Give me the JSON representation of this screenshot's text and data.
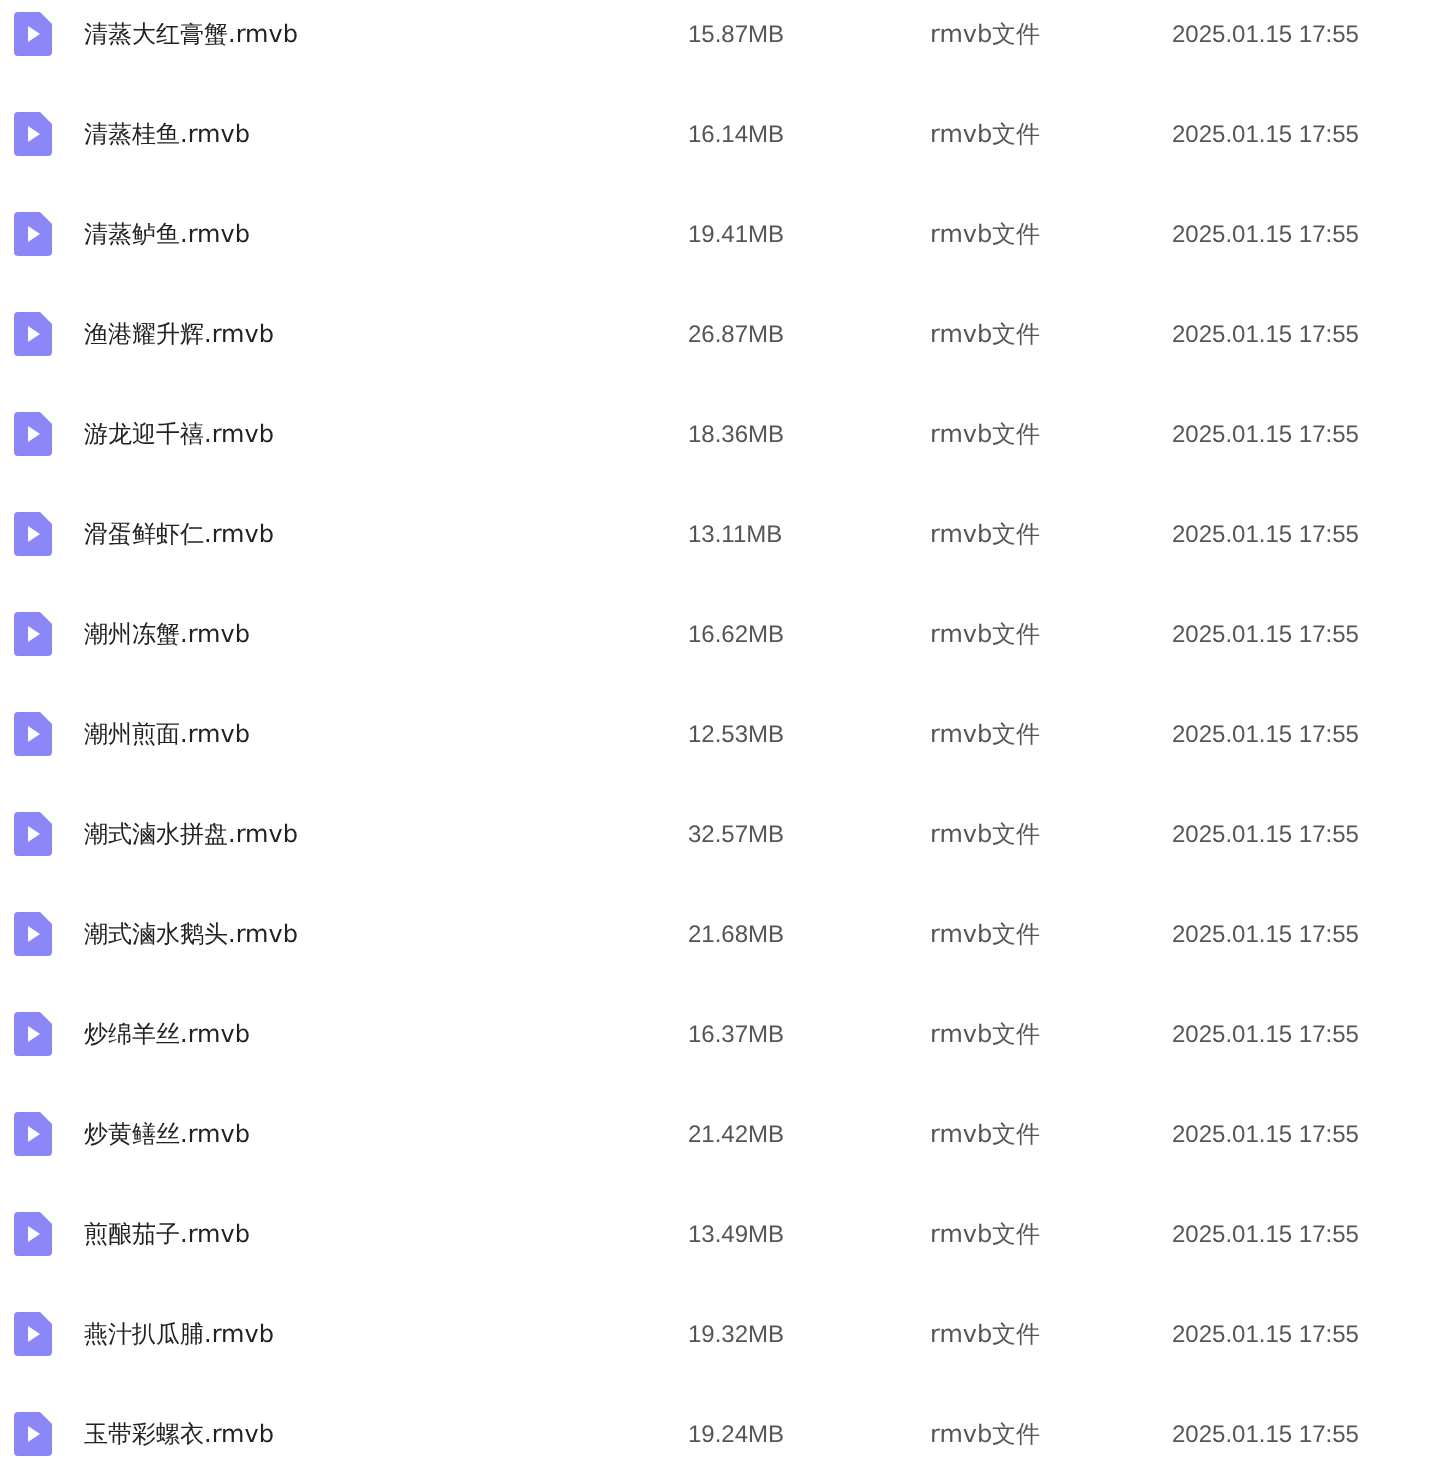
{
  "files": [
    {
      "name": "清蒸大红膏蟹.rmvb",
      "size": "15.87MB",
      "type": "rmvb文件",
      "date": "2025.01.15 17:55"
    },
    {
      "name": "清蒸桂鱼.rmvb",
      "size": "16.14MB",
      "type": "rmvb文件",
      "date": "2025.01.15 17:55"
    },
    {
      "name": "清蒸鲈鱼.rmvb",
      "size": "19.41MB",
      "type": "rmvb文件",
      "date": "2025.01.15 17:55"
    },
    {
      "name": "渔港耀升辉.rmvb",
      "size": "26.87MB",
      "type": "rmvb文件",
      "date": "2025.01.15 17:55"
    },
    {
      "name": "游龙迎千禧.rmvb",
      "size": "18.36MB",
      "type": "rmvb文件",
      "date": "2025.01.15 17:55"
    },
    {
      "name": "滑蛋鲜虾仁.rmvb",
      "size": "13.11MB",
      "type": "rmvb文件",
      "date": "2025.01.15 17:55"
    },
    {
      "name": "潮州冻蟹.rmvb",
      "size": "16.62MB",
      "type": "rmvb文件",
      "date": "2025.01.15 17:55"
    },
    {
      "name": "潮州煎面.rmvb",
      "size": "12.53MB",
      "type": "rmvb文件",
      "date": "2025.01.15 17:55"
    },
    {
      "name": "潮式滷水拼盘.rmvb",
      "size": "32.57MB",
      "type": "rmvb文件",
      "date": "2025.01.15 17:55"
    },
    {
      "name": "潮式滷水鹅头.rmvb",
      "size": "21.68MB",
      "type": "rmvb文件",
      "date": "2025.01.15 17:55"
    },
    {
      "name": "炒绵羊丝.rmvb",
      "size": "16.37MB",
      "type": "rmvb文件",
      "date": "2025.01.15 17:55"
    },
    {
      "name": "炒黄鳝丝.rmvb",
      "size": "21.42MB",
      "type": "rmvb文件",
      "date": "2025.01.15 17:55"
    },
    {
      "name": "煎酿茄子.rmvb",
      "size": "13.49MB",
      "type": "rmvb文件",
      "date": "2025.01.15 17:55"
    },
    {
      "name": "燕汁扒瓜脯.rmvb",
      "size": "19.32MB",
      "type": "rmvb文件",
      "date": "2025.01.15 17:55"
    },
    {
      "name": "玉带彩螺衣.rmvb",
      "size": "19.24MB",
      "type": "rmvb文件",
      "date": "2025.01.15 17:55"
    }
  ]
}
